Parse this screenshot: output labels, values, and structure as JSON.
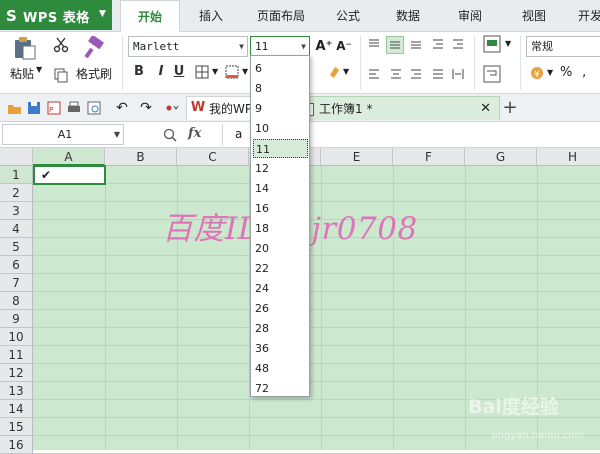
{
  "app": {
    "name": "WPS 表格",
    "logo": "S"
  },
  "menu_tabs": [
    "开始",
    "插入",
    "页面布局",
    "公式",
    "数据",
    "审阅",
    "视图",
    "开发"
  ],
  "ribbon": {
    "paste_label": "粘贴",
    "format_painter_label": "格式刷",
    "font_name": "Marlett",
    "font_size": "11",
    "bold": "B",
    "italic": "I",
    "underline": "U",
    "number_format": "常规",
    "percent": "%"
  },
  "doc_tabs": [
    {
      "label": "我的WPS"
    },
    {
      "label": "工作簿1 *"
    }
  ],
  "formula_bar": {
    "name_box": "A1",
    "fx": "fx",
    "value": "a"
  },
  "columns": [
    "A",
    "B",
    "C",
    "D",
    "E",
    "F",
    "G",
    "H"
  ],
  "rows": [
    "1",
    "2",
    "3",
    "4",
    "5",
    "6",
    "7",
    "8",
    "9",
    "10",
    "11",
    "12",
    "13",
    "14",
    "15",
    "16"
  ],
  "active_cell": {
    "ref": "A1",
    "content": "✔"
  },
  "font_size_options": [
    "6",
    "8",
    "9",
    "10",
    "11",
    "12",
    "14",
    "16",
    "18",
    "20",
    "22",
    "24",
    "26",
    "28",
    "36",
    "48",
    "72"
  ],
  "selected_font_size": "11",
  "watermark": "百度ID:zhjr0708",
  "baidu_logo": "Bai度经验",
  "baidu_sub": "jingyan.baidu.com",
  "colors": {
    "accent": "#2e8b3e",
    "grid_bg": "#cce8cf",
    "watermark": "#e063b4"
  }
}
